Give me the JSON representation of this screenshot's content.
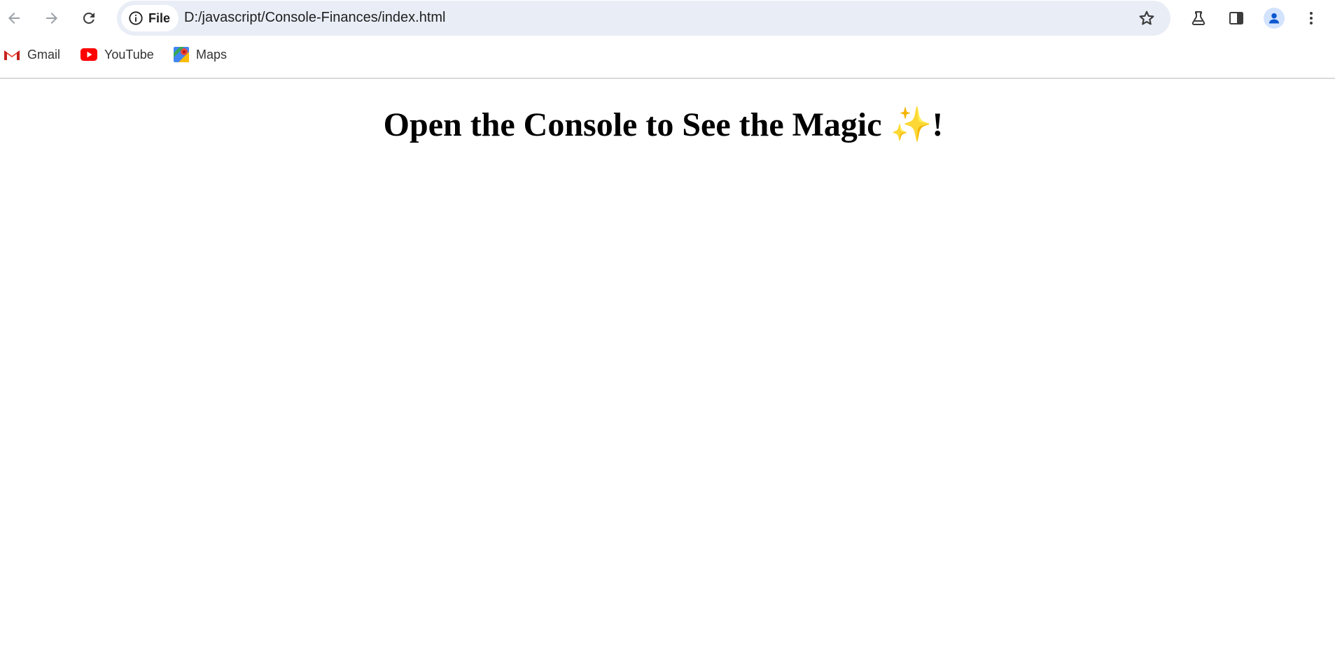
{
  "toolbar": {
    "back_icon": "arrow-left-icon",
    "forward_icon": "arrow-right-icon",
    "reload_icon": "reload-icon",
    "site_info": {
      "icon": "info-circle-icon",
      "label": "File"
    },
    "url": "D:/javascript/Console-Finances/index.html",
    "bookmark_star_icon": "star-outline-icon",
    "labs_icon": "flask-icon",
    "side_panel_icon": "side-panel-icon",
    "profile_icon": "avatar-icon",
    "menu_icon": "more-vert-icon"
  },
  "bookmarks": [
    {
      "label": "Gmail",
      "icon": "gmail-icon"
    },
    {
      "label": "YouTube",
      "icon": "youtube-icon"
    },
    {
      "label": "Maps",
      "icon": "maps-icon"
    }
  ],
  "page": {
    "heading": "Open the Console to See the Magic ✨!"
  },
  "colors": {
    "omnibox_bg": "#e9edf6",
    "avatar_bg": "#d3e3fd",
    "avatar_fg": "#0b57d0",
    "youtube_red": "#ff0000"
  }
}
